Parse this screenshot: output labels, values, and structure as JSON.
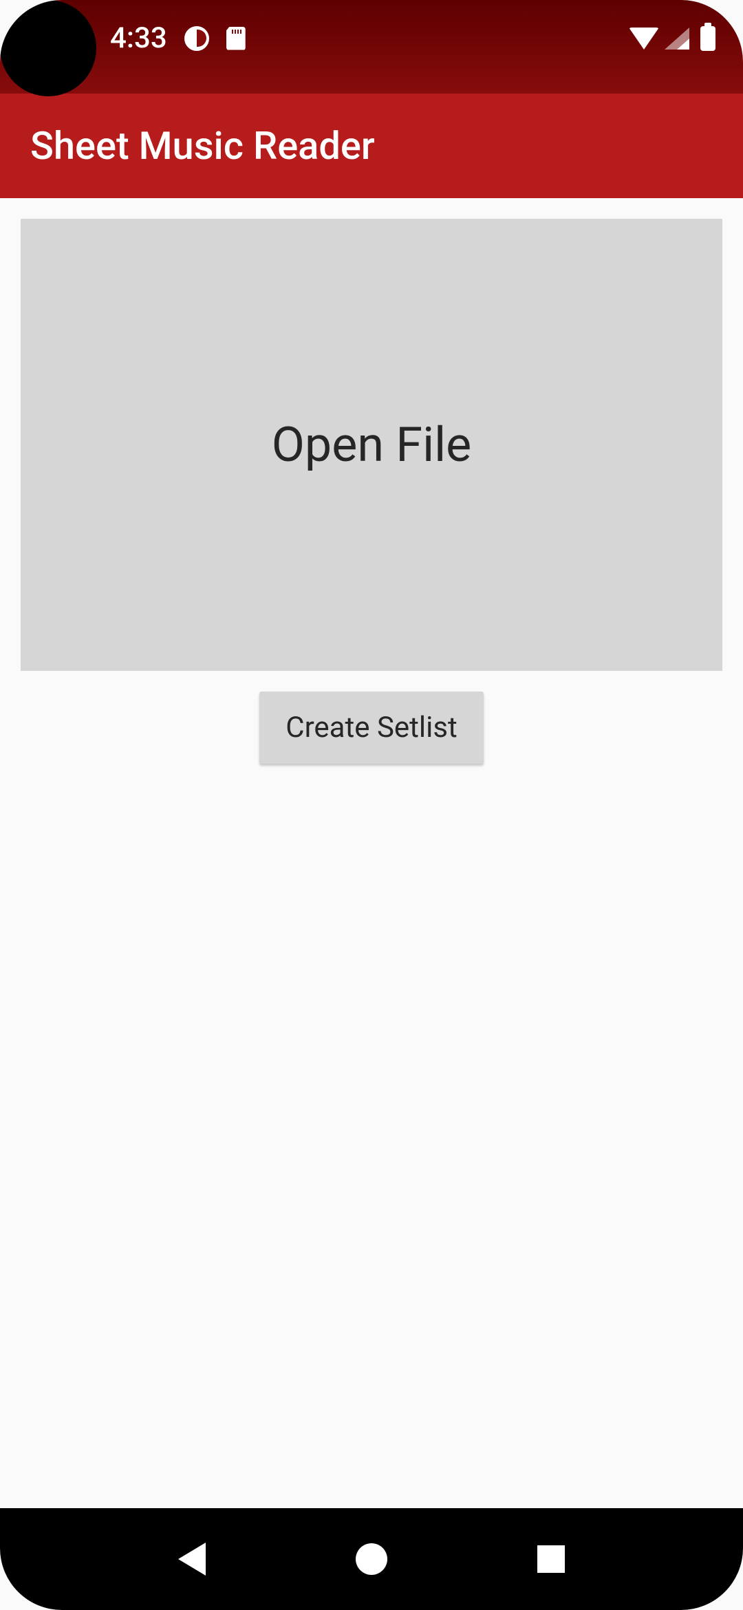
{
  "status_bar": {
    "time": "4:33"
  },
  "app_bar": {
    "title": "Sheet Music Reader"
  },
  "main": {
    "open_file_label": "Open File",
    "create_setlist_label": "Create Setlist"
  }
}
